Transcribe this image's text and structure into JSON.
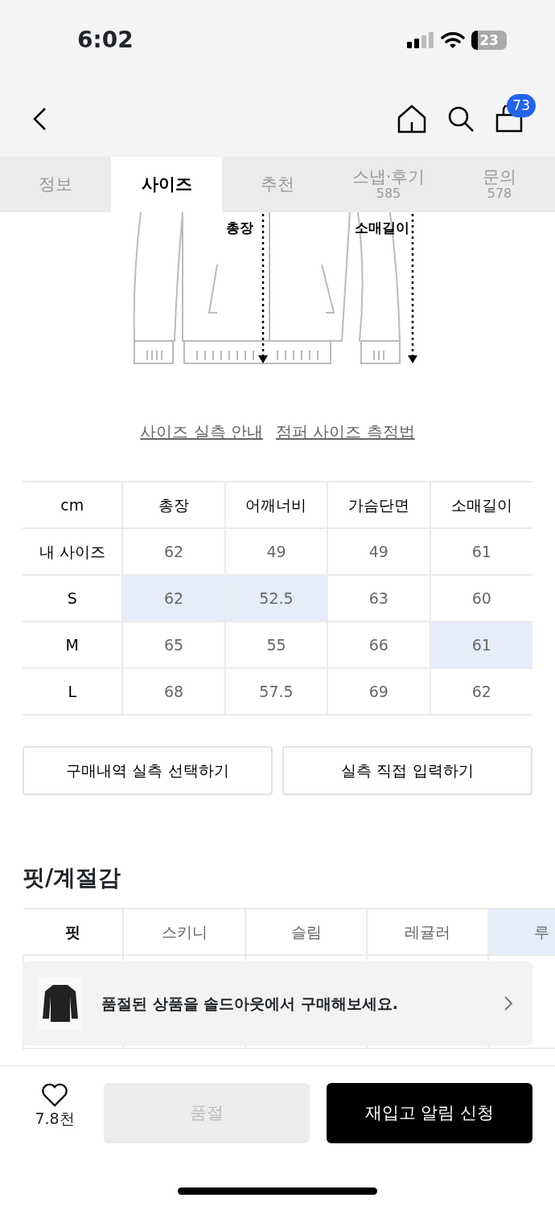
{
  "status_bar": {
    "time": "6:02",
    "battery": "23"
  },
  "nav": {
    "cart_count": "73"
  },
  "tabs": [
    {
      "label": "정보",
      "selected": false
    },
    {
      "label": "사이즈",
      "selected": true
    },
    {
      "label": "추천",
      "selected": false
    },
    {
      "label": "스냅·후기",
      "count": "585",
      "selected": false
    },
    {
      "label": "문의",
      "count": "578",
      "selected": false
    }
  ],
  "diagram": {
    "labels": [
      "총장",
      "소매길이"
    ]
  },
  "links": [
    "사이즈 실측 안내",
    "점퍼 사이즈 측정법"
  ],
  "size_table": {
    "corner": "cm",
    "columns": [
      "총장",
      "어깨너비",
      "가슴단면",
      "소매길이"
    ],
    "rows": [
      {
        "label": "내 사이즈",
        "cells": [
          {
            "value": "62",
            "highlighted": false
          },
          {
            "value": "49",
            "highlighted": false
          },
          {
            "value": "49",
            "highlighted": false
          },
          {
            "value": "61",
            "highlighted": false
          }
        ]
      },
      {
        "label": "S",
        "cells": [
          {
            "value": "62",
            "highlighted": true
          },
          {
            "value": "52.5",
            "highlighted": true
          },
          {
            "value": "63",
            "highlighted": false
          },
          {
            "value": "60",
            "highlighted": false
          }
        ]
      },
      {
        "label": "M",
        "cells": [
          {
            "value": "65",
            "highlighted": false
          },
          {
            "value": "55",
            "highlighted": false
          },
          {
            "value": "66",
            "highlighted": false
          },
          {
            "value": "61",
            "highlighted": true
          }
        ]
      },
      {
        "label": "L",
        "cells": [
          {
            "value": "68",
            "highlighted": false
          },
          {
            "value": "57.5",
            "highlighted": false
          },
          {
            "value": "69",
            "highlighted": false
          },
          {
            "value": "62",
            "highlighted": false
          }
        ]
      }
    ]
  },
  "size_buttons": [
    "구매내역 실측 선택하기",
    "실측 직접 입력하기"
  ],
  "fit_section": {
    "title": "핏/계절감",
    "label": "핏",
    "options": [
      {
        "label": "스키니",
        "selected": false
      },
      {
        "label": "슬림",
        "selected": false
      },
      {
        "label": "레귤러",
        "selected": false
      },
      {
        "label": "루",
        "selected": true
      }
    ]
  },
  "toast": {
    "text": "품절된 상품을 솔드아웃에서 구매해보세요."
  },
  "bottom_bar": {
    "likes": "7.8천",
    "sold_out_button": "품절",
    "restock_button": "재입고 알림 신청"
  }
}
